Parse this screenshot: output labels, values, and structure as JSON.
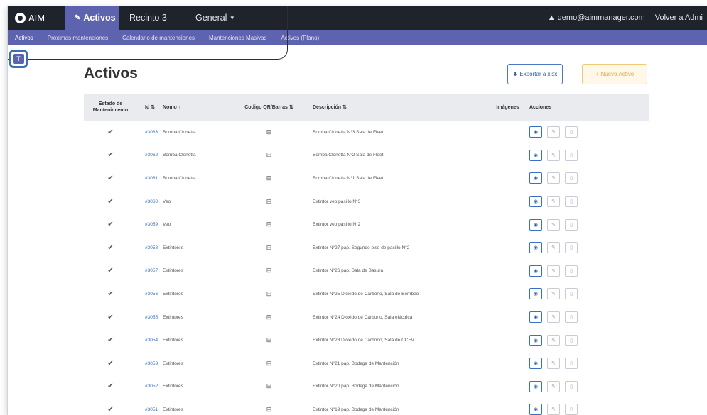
{
  "topbar": {
    "brand": "AIM",
    "tabs": [
      {
        "label": "Activos",
        "active": true
      },
      {
        "label": "Recinto 3",
        "active": false
      },
      {
        "label": "-",
        "active": false
      },
      {
        "label": "General",
        "active": false
      }
    ],
    "user": "demo@aimmanager.com",
    "back_link": "Volver a Admi"
  },
  "subnav": {
    "items": [
      "Activos",
      "Próximas mantenciones",
      "Calendario de mantenciones",
      "Mantenciones Masivas",
      "Activos (Plano)"
    ]
  },
  "filter": {
    "icon": "filter-icon",
    "label": "T"
  },
  "page": {
    "title": "Activos",
    "export_label": "Exportar a xlsx",
    "new_label": "Nuevo Activo"
  },
  "table": {
    "headers": {
      "state": "Estado de Mantenimiento",
      "id": "Id ⇅",
      "name": "Nomo ↑",
      "qr": "Codigo QR/Barras ⇅",
      "desc": "Descripción ⇅",
      "images": "Imágenes",
      "actions": "Acciones"
    },
    "rows": [
      {
        "state": "✔",
        "id": "#3063",
        "name": "Bomba Clonetta",
        "qr": "⊞",
        "desc": "Bomba Clonetta N°3 Sala de Fleet"
      },
      {
        "state": "✔",
        "id": "#3062",
        "name": "Bomba Clonetta",
        "qr": "⊞",
        "desc": "Bomba Clonetta N°2 Sala de Fleet"
      },
      {
        "state": "✔",
        "id": "#3061",
        "name": "Bomba Clonetta",
        "qr": "⊞",
        "desc": "Bomba Clonetta N°1 Sala de Fleet"
      },
      {
        "state": "✔",
        "id": "#3060",
        "name": "Veo",
        "qr": "⊞",
        "desc": "Extintor veo pasillo N°3"
      },
      {
        "state": "✔",
        "id": "#3059",
        "name": "Veo",
        "qr": "⊞",
        "desc": "Extintor veo pasillo N°2"
      },
      {
        "state": "✔",
        "id": "#3058",
        "name": "Extintores",
        "qr": "⊞",
        "desc": "Extintor N°27 pap. Segundo piso de pasillo N°2"
      },
      {
        "state": "✔",
        "id": "#3057",
        "name": "Extintores",
        "qr": "⊞",
        "desc": "Extintor N°26 pap. Sala de Basura"
      },
      {
        "state": "✔",
        "id": "#3056",
        "name": "Extintores",
        "qr": "⊞",
        "desc": "Extintor N°25 Dióxido de Carbono, Sala de Bombeo"
      },
      {
        "state": "✔",
        "id": "#3055",
        "name": "Extintores",
        "qr": "⊞",
        "desc": "Extintor N°24 Dióxido de Carbono, Sala eléctrica"
      },
      {
        "state": "✔",
        "id": "#3054",
        "name": "Extintores",
        "qr": "⊞",
        "desc": "Extintor N°23 Dióxido de Carbono, Sala de CCFV"
      },
      {
        "state": "✔",
        "id": "#3053",
        "name": "Extintores",
        "qr": "⊞",
        "desc": "Extintor N°21 pap. Bodega de Mantención"
      },
      {
        "state": "✔",
        "id": "#3052",
        "name": "Extintores",
        "qr": "⊞",
        "desc": "Extintor N°20 pap. Bodega de Mantención"
      },
      {
        "state": "✔",
        "id": "#3051",
        "name": "Extintores",
        "qr": "⊞",
        "desc": "Extintor N°19 pap. Bodega de Mantención"
      }
    ]
  }
}
